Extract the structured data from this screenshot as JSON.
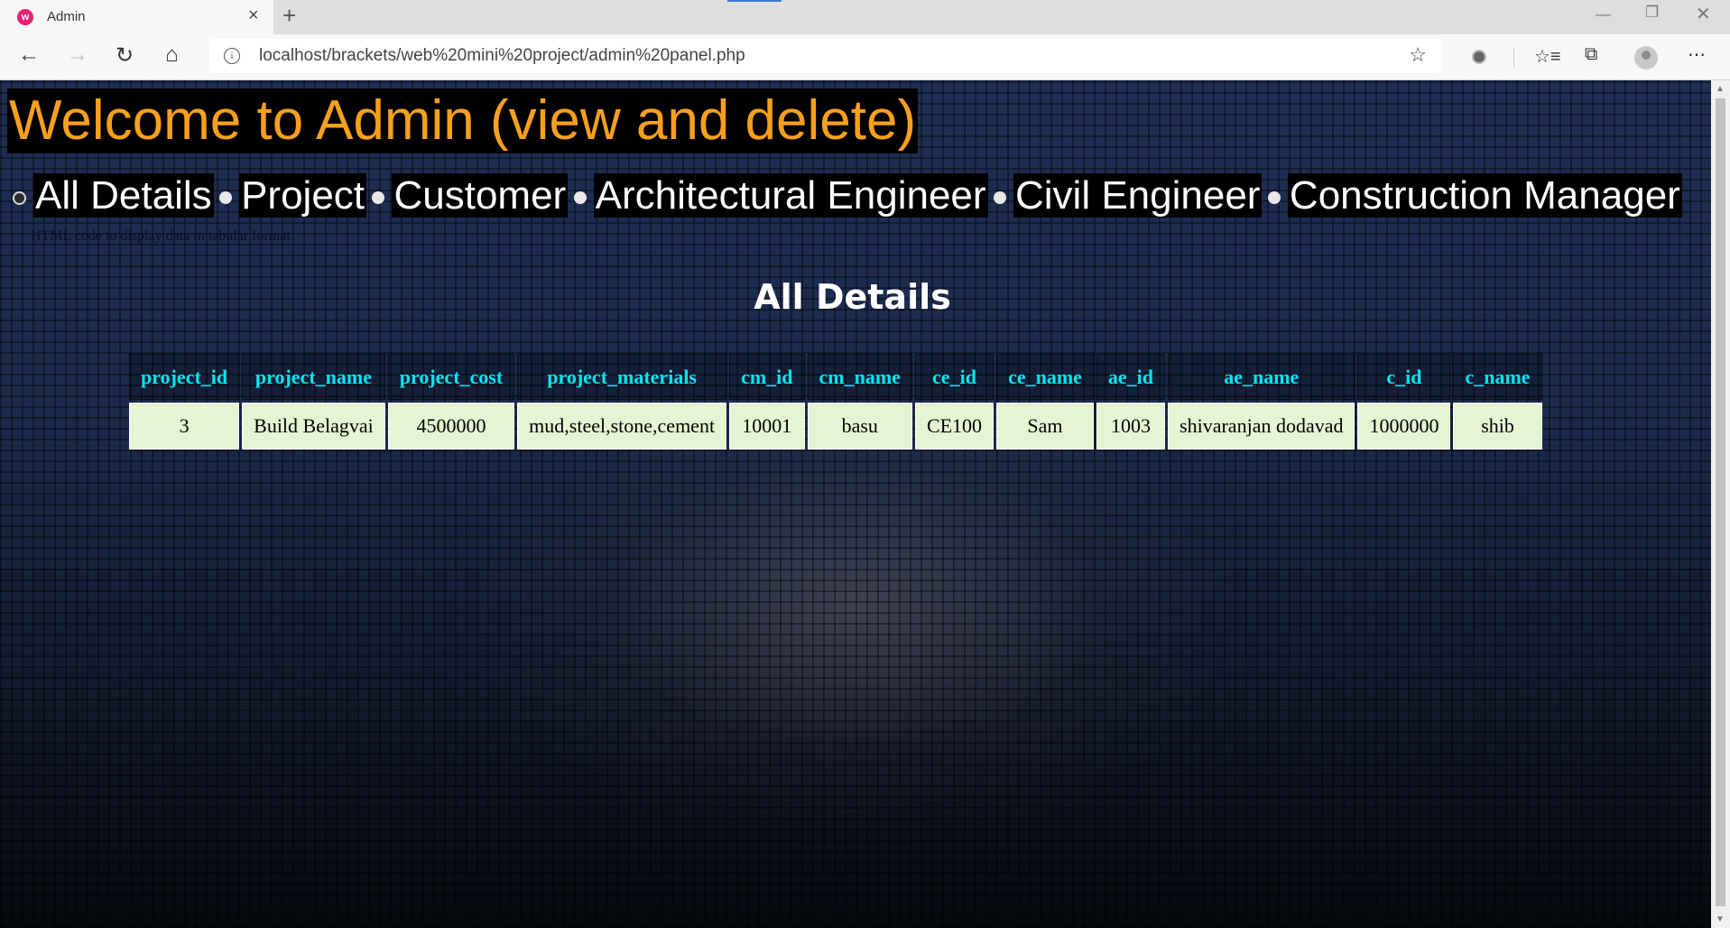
{
  "browser": {
    "tab_title": "Admin",
    "tab_favicon_letter": "w",
    "url": "localhost/brackets/web%20mini%20project/admin%20panel.php",
    "icons": {
      "back": "back-arrow-icon",
      "forward": "forward-arrow-icon",
      "refresh": "refresh-icon",
      "home": "home-icon",
      "info": "info-icon",
      "favorite": "star-icon",
      "favorites": "favorites-list-icon",
      "collections": "collections-icon",
      "profile": "avatar",
      "menu": "more-icon"
    }
  },
  "page": {
    "heading": "Welcome to Admin (view and delete)",
    "nav": [
      {
        "label": "All Details"
      },
      {
        "label": "Project"
      },
      {
        "label": "Customer"
      },
      {
        "label": "Architectural Engineer"
      },
      {
        "label": "Civil Engineer"
      },
      {
        "label": "Construction Manager"
      }
    ],
    "hidden_comment": "HTML code to display data in tabular format",
    "section_title": "All Details",
    "table": {
      "headers": [
        "project_id",
        "project_name",
        "project_cost",
        "project_materials",
        "cm_id",
        "cm_name",
        "ce_id",
        "ce_name",
        "ae_id",
        "ae_name",
        "c_id",
        "c_name"
      ],
      "rows": [
        [
          "3",
          "Build Belagvai",
          "4500000",
          "mud,steel,stone,cement",
          "10001",
          "basu",
          "CE100",
          "Sam",
          "1003",
          "shivaranjan dodavad",
          "1000000",
          "shib"
        ]
      ]
    }
  },
  "colors": {
    "heading": "#f7a01d",
    "nav_text": "#ffffff",
    "table_header": "#00e8f0",
    "table_cell_bg": "#e5f5d3"
  }
}
